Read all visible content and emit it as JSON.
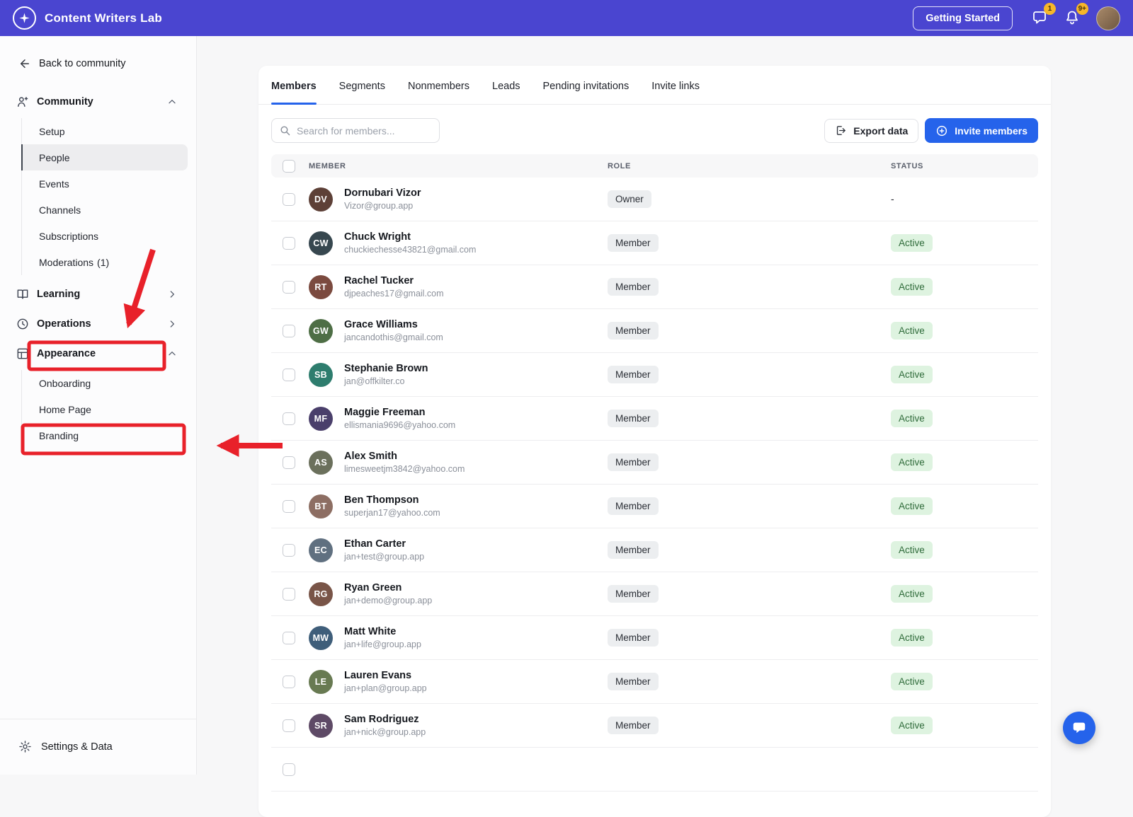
{
  "colors": {
    "topbar_bg": "#4a45d0",
    "accent_blue": "#2563eb",
    "annotation_red": "#e8212a",
    "active_bg": "#def3e0",
    "active_text": "#2f6b3a",
    "badge_yellow": "#f6b62a"
  },
  "icons": {
    "logo": "four-point-star-in-circle",
    "messages": "speech-bubble",
    "notifications": "bell",
    "back": "arrow-left",
    "community": "person-sparkle",
    "learning": "open-book",
    "operations": "clock",
    "appearance": "layout-grid",
    "settings": "gear",
    "chevron_expanded": "chevron-up",
    "chevron_collapsed": "chevron-right",
    "search": "magnifier",
    "export": "arrow-out-of-box",
    "invite": "plus-circle",
    "chat_widget": "speech-bubble-filled"
  },
  "topbar": {
    "brand": "Content Writers Lab",
    "getting_started_label": "Getting Started",
    "messages_badge": "1",
    "notifications_badge": "9+"
  },
  "sidebar": {
    "back_label": "Back to community",
    "community": {
      "label": "Community",
      "items": [
        {
          "label": "Setup"
        },
        {
          "label": "People",
          "selected": true
        },
        {
          "label": "Events"
        },
        {
          "label": "Channels"
        },
        {
          "label": "Subscriptions"
        },
        {
          "label": "Moderations",
          "count": "(1)"
        }
      ]
    },
    "learning_label": "Learning",
    "operations_label": "Operations",
    "appearance": {
      "label": "Appearance",
      "items": [
        {
          "label": "Onboarding"
        },
        {
          "label": "Home Page"
        },
        {
          "label": "Branding",
          "annotated": true
        }
      ]
    },
    "settings_label": "Settings & Data"
  },
  "main": {
    "tabs": [
      {
        "label": "Members",
        "active": true
      },
      {
        "label": "Segments"
      },
      {
        "label": "Nonmembers"
      },
      {
        "label": "Leads"
      },
      {
        "label": "Pending invitations"
      },
      {
        "label": "Invite links"
      }
    ],
    "search_placeholder": "Search for members...",
    "export_label": "Export data",
    "invite_label": "Invite members",
    "table": {
      "headers": {
        "member": "MEMBER",
        "role": "ROLE",
        "status": "STATUS"
      },
      "rows": [
        {
          "name": "Dornubari Vizor",
          "email": "Vizor@group.app",
          "role": "Owner",
          "status": "-",
          "status_variant": "text",
          "avatar_color": "#5d4037"
        },
        {
          "name": "Chuck Wright",
          "email": "chuckiechesse43821@gmail.com",
          "role": "Member",
          "status": "Active",
          "status_variant": "pill",
          "avatar_color": "#37474f"
        },
        {
          "name": "Rachel Tucker",
          "email": "djpeaches17@gmail.com",
          "role": "Member",
          "status": "Active",
          "status_variant": "pill",
          "avatar_color": "#7b4a3f"
        },
        {
          "name": "Grace Williams",
          "email": "jancandothis@gmail.com",
          "role": "Member",
          "status": "Active",
          "status_variant": "pill",
          "avatar_color": "#4e6e45"
        },
        {
          "name": "Stephanie Brown",
          "email": "jan@offkilter.co",
          "role": "Member",
          "status": "Active",
          "status_variant": "pill",
          "avatar_color": "#2e7d6e"
        },
        {
          "name": "Maggie Freeman",
          "email": "ellismania9696@yahoo.com",
          "role": "Member",
          "status": "Active",
          "status_variant": "pill",
          "avatar_color": "#4a3f6b"
        },
        {
          "name": "Alex Smith",
          "email": "limesweetjm3842@yahoo.com",
          "role": "Member",
          "status": "Active",
          "status_variant": "pill",
          "avatar_color": "#6b705c"
        },
        {
          "name": "Ben Thompson",
          "email": "superjan17@yahoo.com",
          "role": "Member",
          "status": "Active",
          "status_variant": "pill",
          "avatar_color": "#8d6e63"
        },
        {
          "name": "Ethan Carter",
          "email": "jan+test@group.app",
          "role": "Member",
          "status": "Active",
          "status_variant": "pill",
          "avatar_color": "#607080"
        },
        {
          "name": "Ryan Green",
          "email": "jan+demo@group.app",
          "role": "Member",
          "status": "Active",
          "status_variant": "pill",
          "avatar_color": "#795548"
        },
        {
          "name": "Matt White",
          "email": "jan+life@group.app",
          "role": "Member",
          "status": "Active",
          "status_variant": "pill",
          "avatar_color": "#3f5e7a"
        },
        {
          "name": "Lauren Evans",
          "email": "jan+plan@group.app",
          "role": "Member",
          "status": "Active",
          "status_variant": "pill",
          "avatar_color": "#687a52"
        },
        {
          "name": "Sam Rodriguez",
          "email": "jan+nick@group.app",
          "role": "Member",
          "status": "Active",
          "status_variant": "pill",
          "avatar_color": "#5e4a66"
        },
        {
          "name": "",
          "email": "",
          "role": "",
          "status": "",
          "status_variant": "text",
          "avatar_color": ""
        }
      ]
    }
  }
}
